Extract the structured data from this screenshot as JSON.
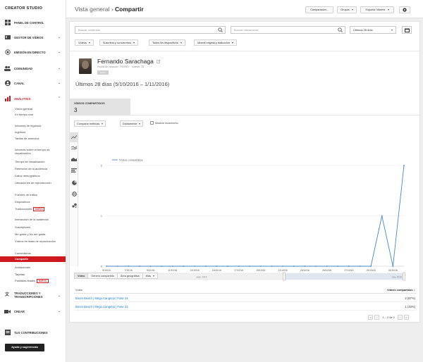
{
  "sidebar": {
    "brand": "CREATOR STUDIO",
    "sections": {
      "panel": "PANEL DE CONTROL",
      "video_manager": "GESTOR DE VÍDEOS",
      "live": "EMISIÓN EN DIRECTO",
      "community": "COMUNIDAD",
      "channel": "CANAL",
      "analytics": "ANALYTICS",
      "translations": "TRADUCCIONES Y TRANSCRIPCIONES",
      "create": "CREAR",
      "contributions": "TUS CONTRIBUCIONES"
    },
    "analytics_items": [
      "Visión general",
      "En tiempo real",
      "Informes de ingresos",
      "Ingresos",
      "Tarifas de anuncios",
      "Informes sobre el tiempo de visualización",
      "Tiempo de visualización",
      "Retención de la audiencia",
      "Datos demográficos",
      "Ubicaciones de reproducción",
      "Fuentes de tráfico",
      "Dispositivos",
      "Traducciones",
      "Interacción de la audiencia",
      "Suscriptores",
      "Me gusta y No me gusta",
      "Vídeos en listas de reproducción",
      "Comentarios",
      "Compartir",
      "Anotaciones",
      "Tarjetas",
      "Pantallas finales"
    ],
    "nuevo_badge": "NUEVO",
    "help_button": "Ayuda y sugerencias"
  },
  "header": {
    "title_prefix": "Vista general ›",
    "title_current": "Compartir",
    "compare_button": "Comparación...",
    "groups_button": "Grupos",
    "export_button": "Exportar informe"
  },
  "filters": {
    "search_content_placeholder": "Buscar contenido",
    "search_location_placeholder": "Buscar ubicaciones",
    "date_select": "Últimos 28 días",
    "videos": "Vídeos",
    "subscribed": "Suscritos y no suscritos",
    "devices": "Todos los dispositivos",
    "language": "Idioma original y traducción"
  },
  "channel": {
    "name": "Fernando Sarachaga",
    "meta": "Fecha de creación: 7/9/2007 · Vídeos: 75",
    "tag": "Editar"
  },
  "date_range": "Últimos 28 días (5/10/2016 – 1/11/2016)",
  "metric": {
    "label": "VÍDEOS COMPARTIDOS",
    "value": "3"
  },
  "chart_controls": {
    "compare_metric": "Comparar métricas",
    "granularity": "Diariamente",
    "show_increase": "Mostrar incremento"
  },
  "chart_data": {
    "type": "line",
    "legend": "Vídeos compartidos",
    "x": [
      "5/10/16",
      "6/10/16",
      "7/10/16",
      "8/10/16",
      "9/10/16",
      "10/10/16",
      "11/10/16",
      "12/10/16",
      "13/10/16",
      "14/10/16",
      "15/10/16",
      "16/10/16",
      "17/10/16",
      "18/10/16",
      "19/10/16",
      "20/10/16",
      "21/10/16",
      "22/10/16",
      "23/10/16",
      "24/10/16",
      "25/10/16",
      "26/10/16",
      "27/10/16",
      "28/10/16",
      "29/10/16",
      "30/10/16",
      "31/10/16",
      "1/11/16"
    ],
    "y": [
      0,
      0,
      0,
      0,
      0,
      0,
      0,
      0,
      0,
      0,
      0,
      0,
      0,
      0,
      0,
      0,
      0,
      0,
      0,
      0,
      0,
      0,
      0,
      0,
      0,
      1,
      0,
      2
    ],
    "x_tick_labels": [
      "5/10/16",
      "7/10/16",
      "9/10/16",
      "11/10/16",
      "13/10/16",
      "15/10/16",
      "17/10/16",
      "19/10/16",
      "21/10/16",
      "23/10/16",
      "25/10/16",
      "27/10/16",
      "29/10/16",
      "31/10/16"
    ],
    "y_ticks": [
      "0",
      "1",
      "2"
    ],
    "ylim": [
      0,
      2
    ],
    "series_color": "#4a86c5",
    "navigator_labels": [
      "sept. 2016",
      "nov. 2016"
    ]
  },
  "bottom_tabs": [
    "Vídeo",
    "Género compartido",
    "Área geográfica",
    "Más"
  ],
  "table": {
    "col_video": "Vídeo",
    "col_shares": "Vídeos compartidos",
    "rows": [
      {
        "title": "Boom Beach | Mega Cangrejo | Fase 24",
        "value": "2 (67%)"
      },
      {
        "title": "Boom Beach | Mega Cangrejo | Fase 23",
        "value": "1 (33%)"
      }
    ],
    "pagination": "1 – 2 de 2"
  },
  "colors": {
    "accent": "#cc181e",
    "link": "#167ac6"
  }
}
